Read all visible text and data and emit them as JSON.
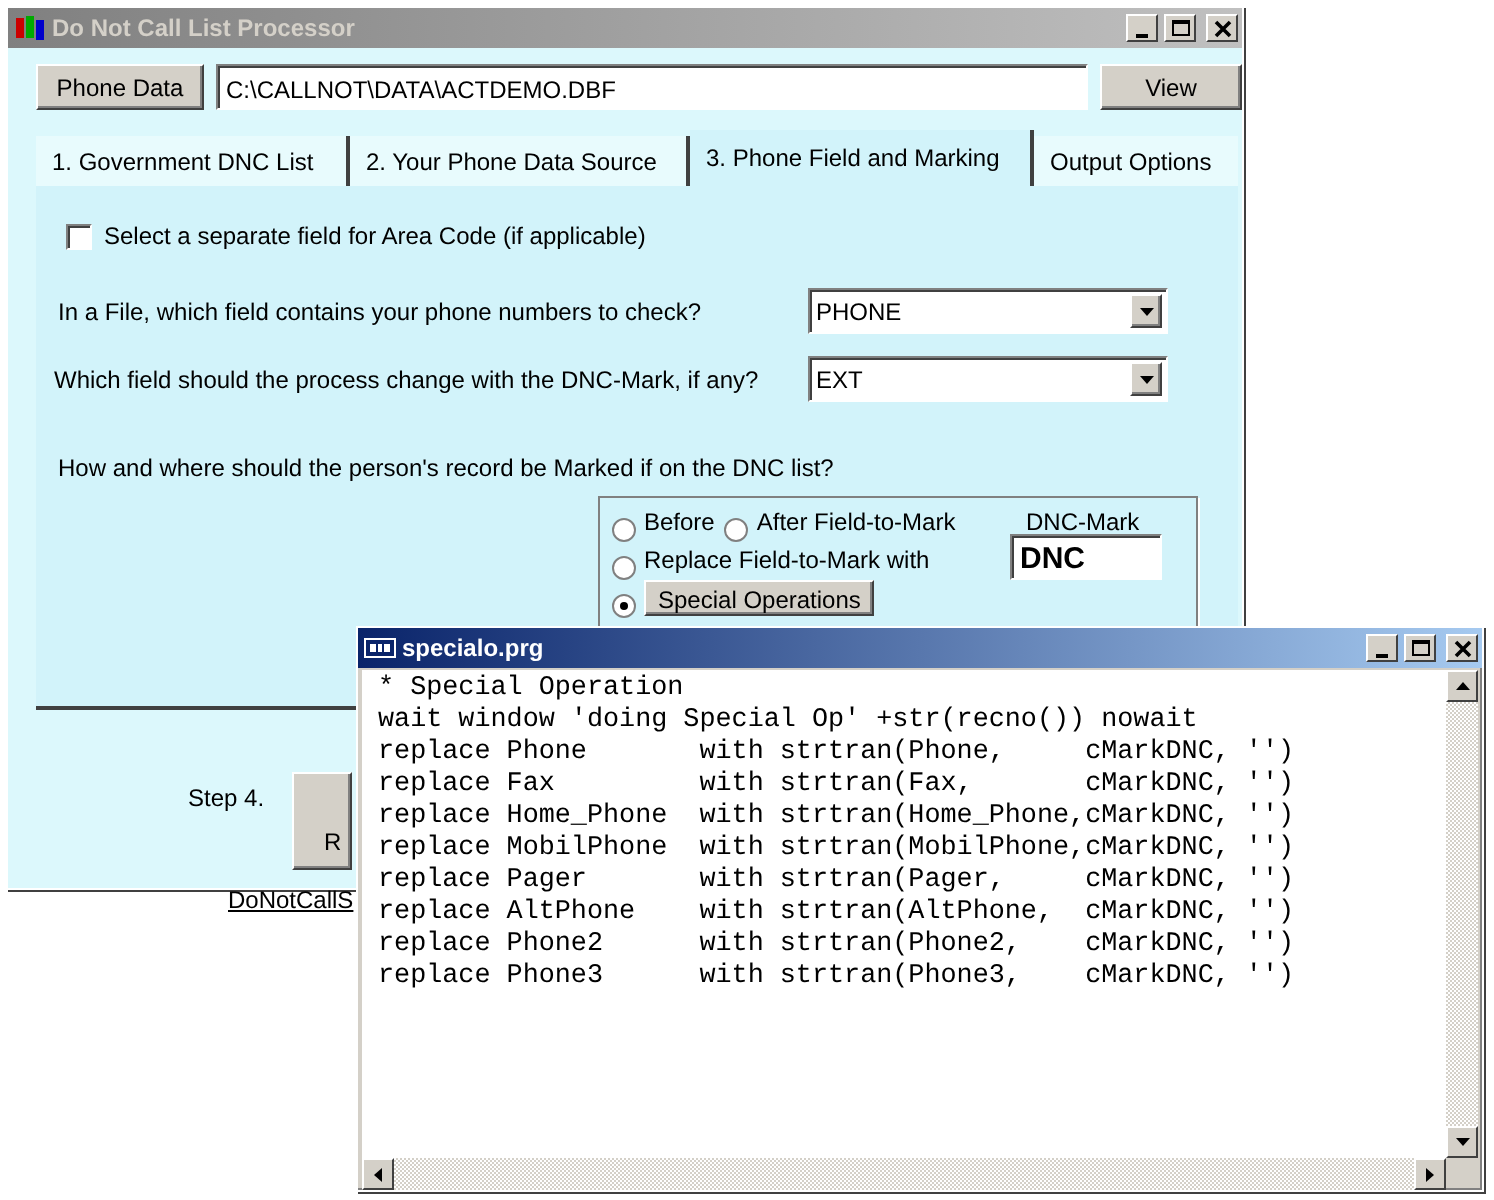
{
  "main_window": {
    "title": "Do Not Call List Processor",
    "phone_data_button": "Phone Data",
    "file_path": "C:\\CALLNOT\\DATA\\ACTDEMO.DBF",
    "view_button": "View",
    "tabs": [
      {
        "label": "1. Government  DNC List",
        "selected": false
      },
      {
        "label": "2. Your Phone Data Source",
        "selected": false
      },
      {
        "label": "3. Phone Field and Marking",
        "selected": true
      },
      {
        "label": "Output Options",
        "selected": false
      }
    ],
    "area_code_checkbox": {
      "label": "Select a separate field for Area Code (if applicable)",
      "checked": false
    },
    "fields": [
      {
        "label": "In a File, which field contains your phone numbers to check?",
        "value": "PHONE"
      },
      {
        "label": "Which field should the process change with the DNC-Mark, if any?",
        "value": "EXT"
      }
    ],
    "marking_question": "How and where should the person's  record be Marked if on the DNC list?",
    "mark_options": [
      {
        "label": "Before",
        "selected": false,
        "kind": "plain"
      },
      {
        "label": "After Field-to-Mark",
        "selected": false,
        "kind": "plain"
      },
      {
        "label": "Replace Field-to-Mark with",
        "selected": false,
        "kind": "plain"
      },
      {
        "label": "Special Operations",
        "selected": true,
        "kind": "button"
      }
    ],
    "dnc_mark": {
      "label": "DNC-Mark",
      "value": "DNC"
    },
    "step_label": "Step 4.",
    "run_button": "R",
    "link": "DoNotCallS"
  },
  "editor_window": {
    "title": "specialo.prg",
    "lines": [
      "* Special Operation",
      "wait window 'doing Special Op' +str(recno()) nowait",
      "replace Phone       with strtran(Phone,     cMarkDNC, '')",
      "replace Fax         with strtran(Fax,       cMarkDNC, '')",
      "replace Home_Phone  with strtran(Home_Phone,cMarkDNC, '')",
      "replace MobilPhone  with strtran(MobilPhone,cMarkDNC, '')",
      "replace Pager       with strtran(Pager,     cMarkDNC, '')",
      "replace AltPhone    with strtran(AltPhone,  cMarkDNC, '')",
      "replace Phone2      with strtran(Phone2,    cMarkDNC, '')",
      "replace Phone3      with strtran(Phone3,    cMarkDNC, '')"
    ]
  }
}
